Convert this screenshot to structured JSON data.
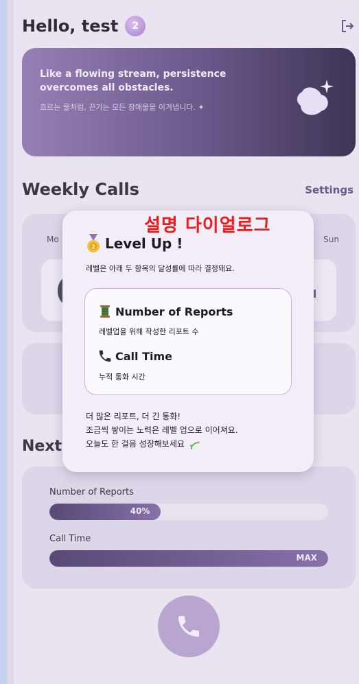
{
  "header": {
    "greeting": "Hello, test",
    "level_badge": "2",
    "logout_icon": "logout-icon"
  },
  "quote": {
    "english": "Like a flowing stream, persistence overcomes all obstacles.",
    "korean": "흐르는 물처럼, 끈기는 모든 장애물을 이겨냅니다. ✦"
  },
  "weekly": {
    "title": "Weekly Calls",
    "settings_label": "Settings",
    "day_start": "Mo",
    "day_end": "Sun"
  },
  "next": {
    "title": "Next",
    "items": [
      {
        "label": "Number of Reports",
        "value_text": "40%",
        "progress": 0.4
      },
      {
        "label": "Call Time",
        "value_text": "MAX",
        "progress": 1.0
      }
    ]
  },
  "annotation": "설명 다이얼로그",
  "dialog": {
    "title": "Level Up !",
    "description": "레벨은 아래 두 항목의 달성률에 따라 결정돼요.",
    "items": [
      {
        "icon": "thread-spool-icon",
        "title": "Number of Reports",
        "subtitle": "레벨업을 위해 작성한 리포트 수"
      },
      {
        "icon": "phone-icon",
        "title": "Call Time",
        "subtitle": "누적 통화 시간"
      }
    ],
    "footer_lines": [
      "더 많은 리포트, 더 긴 통화!",
      "조금씩 쌓이는 노력은 레벨 업으로 이어져요.",
      "오늘도 한 걸음 성장해보세요"
    ]
  },
  "colors": {
    "accent": "#5b4c7d",
    "annotation": "#f01a1a",
    "dialog_bg": "#f3edf8"
  }
}
